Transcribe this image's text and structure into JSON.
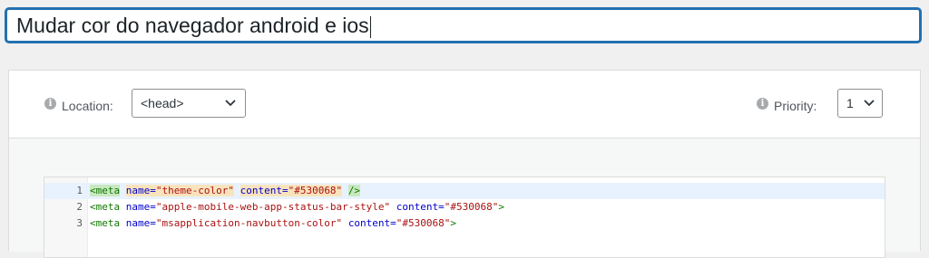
{
  "post": {
    "title": "Mudar cor do navegador android e ios"
  },
  "settings": {
    "location_label": "Location:",
    "location_value": "<head>",
    "priority_label": "Priority:",
    "priority_value": "1"
  },
  "code": {
    "lines": [
      {
        "number": "1",
        "tag_open": "<meta",
        "attr1": "name=",
        "val1": "\"theme-color\"",
        "attr2": "content=",
        "val2": "\"#530068\"",
        "tag_close": "/>"
      },
      {
        "number": "2",
        "tag_open": "<meta",
        "attr1": "name=",
        "val1": "\"apple-mobile-web-app-status-bar-style\"",
        "attr2": "content=",
        "val2": "\"#530068\"",
        "tag_close": ">"
      },
      {
        "number": "3",
        "tag_open": "<meta",
        "attr1": "name=",
        "val1": "\"msapplication-navbutton-color\"",
        "attr2": "content=",
        "val2": "\"#530068\"",
        "tag_close": ">"
      }
    ]
  },
  "colors": {
    "accent": "#2271b1",
    "code_value_color": "#530068"
  },
  "icons": {
    "location_info": "info-icon",
    "priority_info": "info-icon",
    "location_dropdown": "chevron-down-icon",
    "priority_dropdown": "chevron-down-icon"
  }
}
